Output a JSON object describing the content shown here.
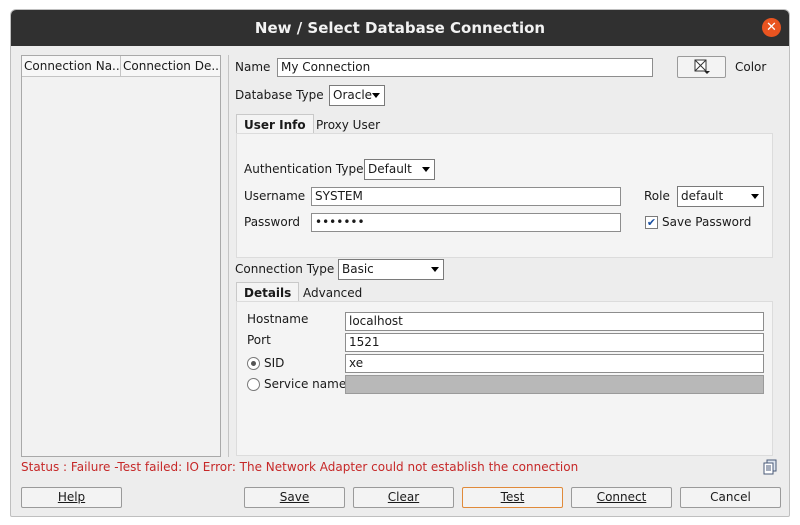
{
  "window": {
    "title": "New / Select Database Connection"
  },
  "connections_table": {
    "columns": [
      "Connection Na...",
      "Connection De..."
    ]
  },
  "form": {
    "name_label": "Name",
    "name_value": "My Connection",
    "color_label": "Color",
    "db_type_label": "Database Type",
    "db_type_value": "Oracle",
    "tabs": [
      "User Info",
      "Proxy User"
    ],
    "auth_type_label": "Authentication Type",
    "auth_type_value": "Default",
    "username_label": "Username",
    "username_value": "SYSTEM",
    "password_label": "Password",
    "password_value": "•••••••",
    "role_label": "Role",
    "role_value": "default",
    "save_password_label": "Save Password",
    "save_password_checked": true,
    "conn_type_label": "Connection Type",
    "conn_type_value": "Basic",
    "detail_tabs": [
      "Details",
      "Advanced"
    ],
    "hostname_label": "Hostname",
    "hostname_value": "localhost",
    "port_label": "Port",
    "port_value": "1521",
    "sid_label": "SID",
    "sid_value": "xe",
    "service_name_label": "Service name",
    "service_name_value": ""
  },
  "status": "Status : Failure -Test failed: IO Error: The Network Adapter could not establish the connection",
  "buttons": {
    "help": "Help",
    "save": "Save",
    "clear": "Clear",
    "test": "Test",
    "connect": "Connect",
    "cancel": "Cancel"
  }
}
